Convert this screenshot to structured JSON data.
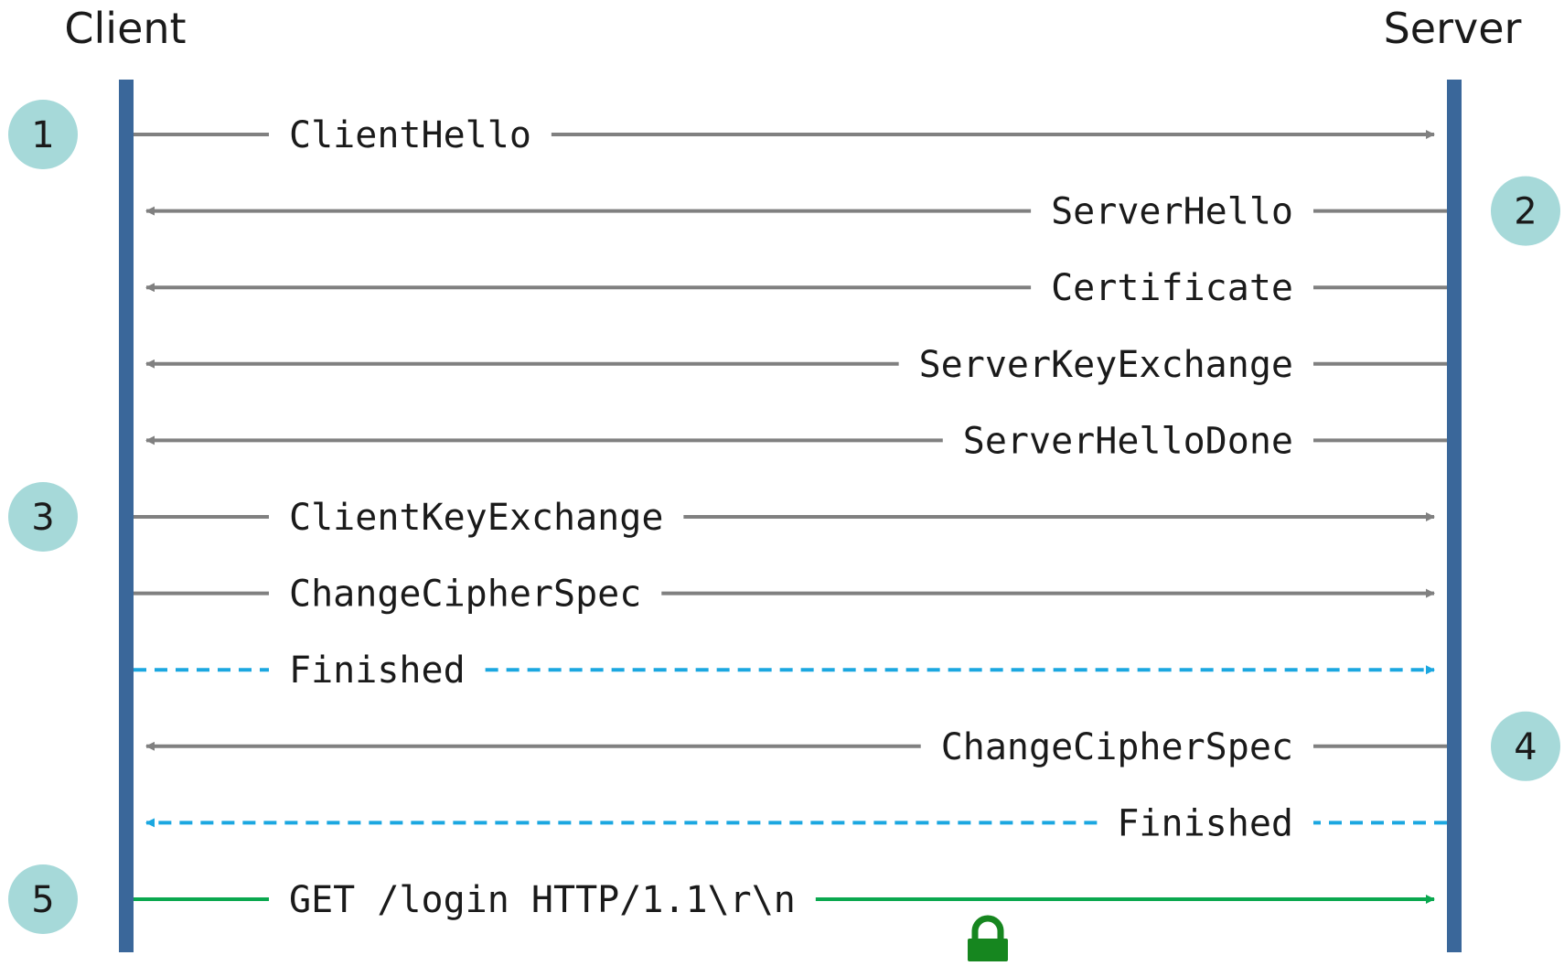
{
  "diagram": {
    "client_label": "Client",
    "server_label": "Server",
    "colors": {
      "lifeline": "#3a679a",
      "solid_arrow": "#808080",
      "dashed_arrow": "#1ba7e0",
      "secure_arrow": "#0aa84f",
      "badge": "#a6d9d9",
      "lock": "#16861f",
      "text": "#1a1a1a"
    },
    "badges": [
      {
        "number": "1",
        "side": "client",
        "row": 0
      },
      {
        "number": "2",
        "side": "server",
        "row": 1
      },
      {
        "number": "3",
        "side": "client",
        "row": 5
      },
      {
        "number": "4",
        "side": "server",
        "row": 8
      },
      {
        "number": "5",
        "side": "client",
        "row": 10
      }
    ],
    "messages": [
      {
        "label": "ClientHello",
        "direction": "to-server",
        "style": "solid"
      },
      {
        "label": "ServerHello",
        "direction": "to-client",
        "style": "solid"
      },
      {
        "label": "Certificate",
        "direction": "to-client",
        "style": "solid"
      },
      {
        "label": "ServerKeyExchange",
        "direction": "to-client",
        "style": "solid"
      },
      {
        "label": "ServerHelloDone",
        "direction": "to-client",
        "style": "solid"
      },
      {
        "label": "ClientKeyExchange",
        "direction": "to-server",
        "style": "solid"
      },
      {
        "label": "ChangeCipherSpec",
        "direction": "to-server",
        "style": "solid"
      },
      {
        "label": "Finished",
        "direction": "to-server",
        "style": "dashed"
      },
      {
        "label": "ChangeCipherSpec",
        "direction": "to-client",
        "style": "solid"
      },
      {
        "label": "Finished",
        "direction": "to-client",
        "style": "dashed"
      },
      {
        "label": "GET /login HTTP/1.1\\r\\n",
        "direction": "to-server",
        "style": "secure"
      }
    ],
    "lock_icon": "padlock-icon"
  }
}
